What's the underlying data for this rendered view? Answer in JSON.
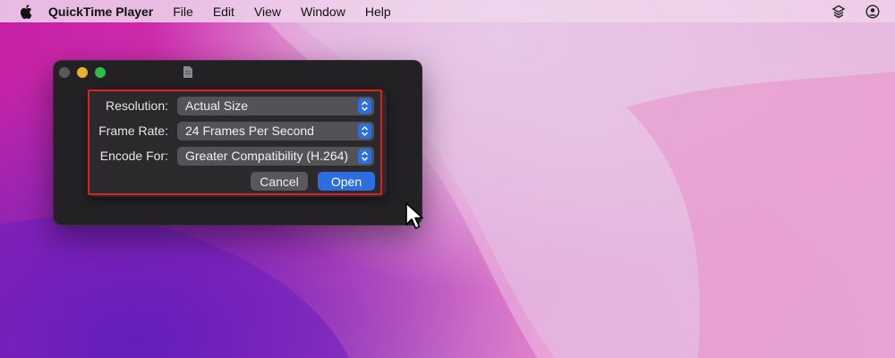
{
  "menubar": {
    "app_name": "QuickTime Player",
    "menus": [
      "File",
      "Edit",
      "View",
      "Window",
      "Help"
    ],
    "icons": [
      "apple-icon",
      "layers-icon",
      "user-circle-icon"
    ]
  },
  "window": {
    "traffic_lights": [
      "close",
      "minimize",
      "zoom"
    ],
    "title_icon": "document-icon"
  },
  "export_sheet": {
    "resolution": {
      "label": "Resolution:",
      "value": "Actual Size"
    },
    "frame_rate": {
      "label": "Frame Rate:",
      "value": "24 Frames Per Second"
    },
    "encode_for": {
      "label": "Encode For:",
      "value": "Greater Compatibility (H.264)"
    },
    "cancel_label": "Cancel",
    "open_label": "Open"
  },
  "colors": {
    "accent_blue": "#2b6ee0",
    "highlight_red": "#e0201e",
    "window_bg": "#232124"
  }
}
